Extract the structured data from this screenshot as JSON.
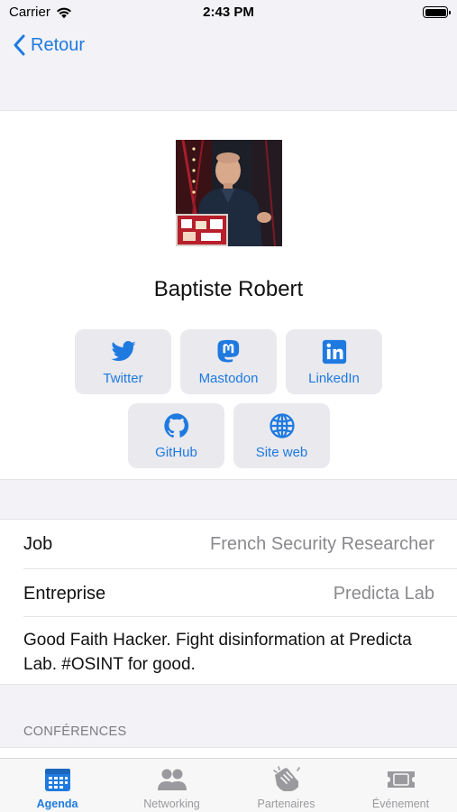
{
  "status_bar": {
    "carrier": "Carrier",
    "time": "2:43 PM"
  },
  "nav": {
    "back_label": "Retour"
  },
  "speaker": {
    "name": "Baptiste Robert"
  },
  "social_links": [
    {
      "label": "Twitter",
      "icon": "twitter-icon"
    },
    {
      "label": "Mastodon",
      "icon": "mastodon-icon"
    },
    {
      "label": "LinkedIn",
      "icon": "linkedin-icon"
    },
    {
      "label": "GitHub",
      "icon": "github-icon"
    },
    {
      "label": "Site web",
      "icon": "globe-icon"
    }
  ],
  "info": {
    "job_label": "Job",
    "job_value": "French Security Researcher",
    "company_label": "Entreprise",
    "company_value": "Predicta Lab",
    "bio": "Good Faith Hacker. Fight disinformation at Predicta Lab. #OSINT for good."
  },
  "sections": {
    "conferences": "CONFÉRENCES"
  },
  "tabs": [
    {
      "label": "Agenda",
      "icon": "calendar-icon",
      "active": true
    },
    {
      "label": "Networking",
      "icon": "people-icon",
      "active": false
    },
    {
      "label": "Partenaires",
      "icon": "handshake-icon",
      "active": false
    },
    {
      "label": "Événement",
      "icon": "ticket-icon",
      "active": false
    }
  ],
  "colors": {
    "accent": "#1f7ae0",
    "background": "#f2f2f7",
    "button_bg": "#e9e9ee",
    "secondary_text": "#8a8a8e"
  }
}
